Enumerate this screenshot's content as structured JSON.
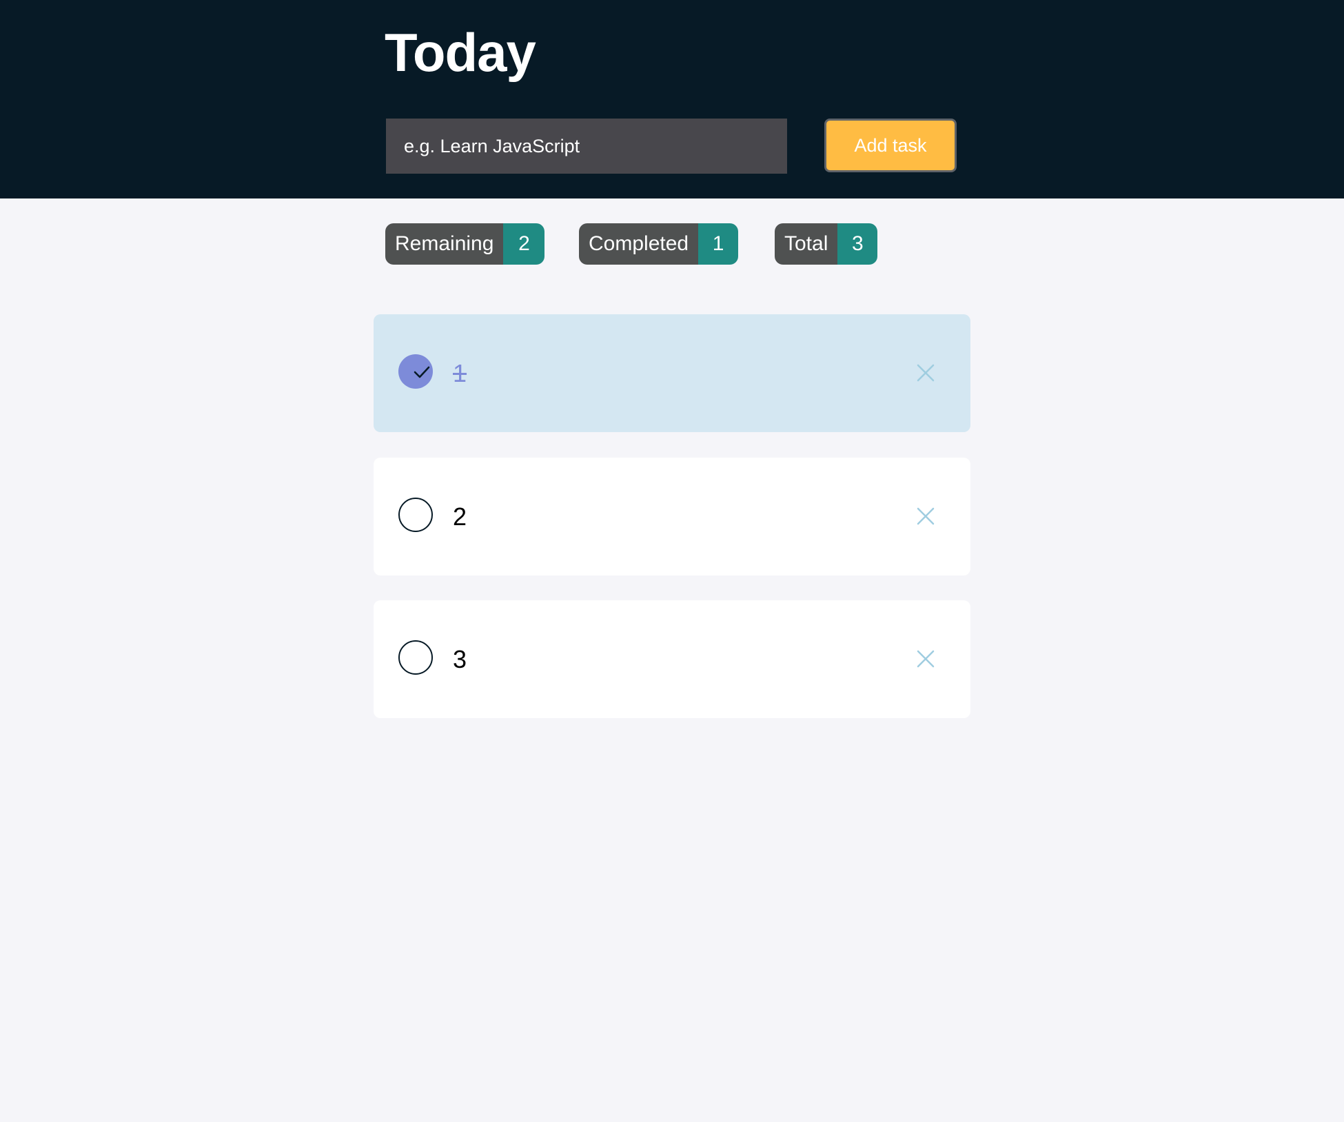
{
  "header": {
    "title": "Today",
    "input_placeholder": "e.g. Learn JavaScript",
    "input_value": "",
    "add_button_label": "Add task"
  },
  "stats": {
    "remaining": {
      "label": "Remaining",
      "count": "2"
    },
    "completed": {
      "label": "Completed",
      "count": "1"
    },
    "total": {
      "label": "Total",
      "count": "3"
    }
  },
  "tasks": [
    {
      "text": "1",
      "completed": true
    },
    {
      "text": "2",
      "completed": false
    },
    {
      "text": "3",
      "completed": false
    }
  ],
  "colors": {
    "header_bg": "#071a26",
    "page_bg": "#f5f5f9",
    "accent": "#ffbc43",
    "badge_count": "#1f8b83",
    "badge_label": "#4f5151",
    "completed_bg": "#d4e7f2",
    "completed_accent": "#7d8bd9",
    "delete_icon": "#9fcde0"
  },
  "icons": {
    "check": "checkmark-icon",
    "delete": "close-icon"
  }
}
